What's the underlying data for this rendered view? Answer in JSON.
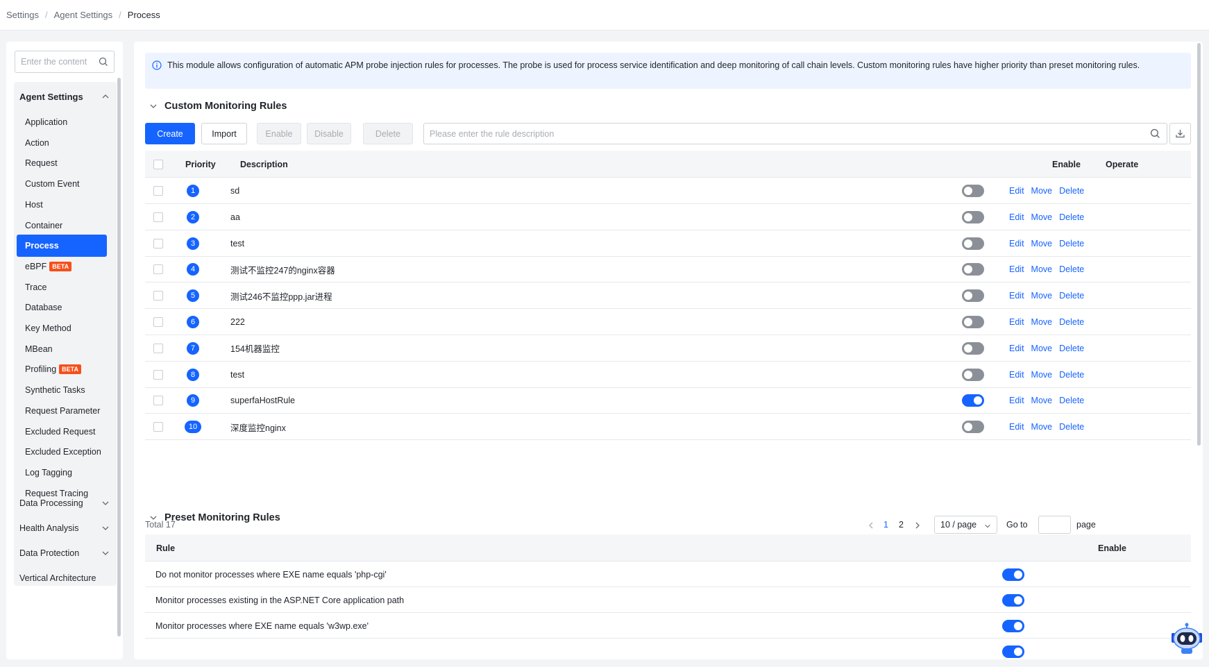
{
  "breadcrumb": [
    "Settings",
    "Agent Settings",
    "Process"
  ],
  "sidebar": {
    "search_placeholder": "Enter the content",
    "group_title": "Agent Settings",
    "items": [
      {
        "label": "Application"
      },
      {
        "label": "Action"
      },
      {
        "label": "Request"
      },
      {
        "label": "Custom Event"
      },
      {
        "label": "Host"
      },
      {
        "label": "Container"
      },
      {
        "label": "Process",
        "active": true
      },
      {
        "label": "eBPF",
        "badge": "BETA"
      },
      {
        "label": "Trace"
      },
      {
        "label": "Database"
      },
      {
        "label": "Key Method"
      },
      {
        "label": "MBean"
      },
      {
        "label": "Profiling",
        "badge": "BETA"
      },
      {
        "label": "Synthetic Tasks"
      },
      {
        "label": "Request Parameter"
      },
      {
        "label": "Excluded Request"
      },
      {
        "label": "Excluded Exception"
      },
      {
        "label": "Log Tagging"
      },
      {
        "label": "Request Tracing"
      }
    ],
    "other_groups": [
      "Data Processing",
      "Health Analysis",
      "Data Protection",
      "Vertical Architecture"
    ]
  },
  "notice": "This module allows configuration of automatic APM probe injection rules for processes. The probe is used for process service identification and deep monitoring of call chain levels. Custom monitoring rules have higher priority than preset monitoring rules.",
  "custom": {
    "title": "Custom Monitoring Rules",
    "buttons": {
      "create": "Create",
      "import": "Import",
      "enable": "Enable",
      "disable": "Disable",
      "delete": "Delete"
    },
    "search_placeholder": "Please enter the rule description",
    "columns": {
      "priority": "Priority",
      "description": "Description",
      "enable": "Enable",
      "operate": "Operate"
    },
    "ops": {
      "edit": "Edit",
      "move": "Move",
      "delete": "Delete"
    },
    "rows": [
      {
        "priority": "1",
        "description": "sd",
        "enabled": false
      },
      {
        "priority": "2",
        "description": "aa",
        "enabled": false
      },
      {
        "priority": "3",
        "description": "test",
        "enabled": false
      },
      {
        "priority": "4",
        "description": "测试不监控247的nginx容器",
        "enabled": false
      },
      {
        "priority": "5",
        "description": "测试246不监控ppp.jar进程",
        "enabled": false
      },
      {
        "priority": "6",
        "description": "222",
        "enabled": false
      },
      {
        "priority": "7",
        "description": "154机器监控",
        "enabled": false
      },
      {
        "priority": "8",
        "description": "test",
        "enabled": false
      },
      {
        "priority": "9",
        "description": "superfaHostRule",
        "enabled": true
      },
      {
        "priority": "10",
        "description": "深度监控nginx",
        "enabled": false
      }
    ]
  },
  "pagination": {
    "total": "Total 17",
    "pages": [
      "1",
      "2"
    ],
    "current": "1",
    "page_size": "10 / page",
    "goto_label": "Go to",
    "page_label": "page"
  },
  "preset": {
    "title": "Preset Monitoring Rules",
    "columns": {
      "rule": "Rule",
      "enable": "Enable"
    },
    "rows": [
      {
        "rule": "Do not monitor processes where EXE name equals 'php-cgi'",
        "enabled": true
      },
      {
        "rule": "Monitor processes existing in the ASP.NET Core application path",
        "enabled": true
      },
      {
        "rule": "Monitor processes where EXE name equals 'w3wp.exe'",
        "enabled": true
      },
      {
        "rule": "",
        "enabled": true
      }
    ]
  },
  "colors": {
    "accent": "#1664ff",
    "beta": "#f5501b",
    "toggle_off": "#8b9098"
  }
}
